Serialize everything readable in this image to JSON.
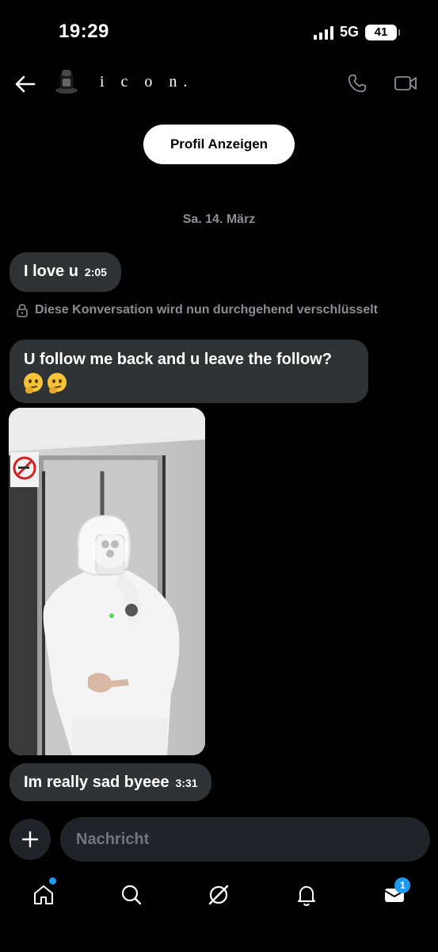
{
  "status_bar": {
    "time": "19:29",
    "network": "5G",
    "battery": "41"
  },
  "header": {
    "name": "i c o n.",
    "back_icon": "arrow-left-icon",
    "call_icon": "phone-icon",
    "video_icon": "video-camera-icon"
  },
  "profile_button": {
    "label": "Profil Anzeigen"
  },
  "date_separator": "Sa. 14. März",
  "messages": [
    {
      "text": "I love u",
      "time": "2:05"
    },
    {
      "text": "U follow me back and u leave the follow?",
      "emoji": [
        "thinking-face",
        "thinking-face"
      ]
    },
    {
      "type": "image",
      "image_description": "mirror selfie in elevator"
    },
    {
      "text": "Im really sad byeee",
      "time": "3:31"
    }
  ],
  "encryption_notice": "Diese Konversation wird nun durchgehend verschlüsselt",
  "composer": {
    "placeholder": "Nachricht"
  },
  "tab_bar": {
    "items": [
      {
        "icon": "home-icon",
        "has_dot": true
      },
      {
        "icon": "search-icon"
      },
      {
        "icon": "grok-icon"
      },
      {
        "icon": "bell-icon"
      },
      {
        "icon": "mail-icon",
        "badge": "1"
      }
    ]
  },
  "colors": {
    "background": "#000000",
    "bubble": "#2f3336",
    "muted": "#8b8f93",
    "accent": "#1d9bf0"
  }
}
